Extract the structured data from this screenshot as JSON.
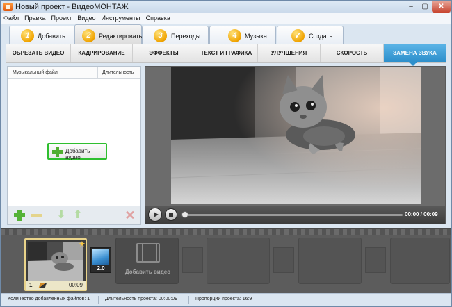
{
  "window": {
    "title": "Новый проект - ВидеоМОНТАЖ"
  },
  "titlebar_buttons": {
    "minimize": "–",
    "maximize": "▢",
    "close": "✕"
  },
  "menu": [
    "Файл",
    "Правка",
    "Проект",
    "Видео",
    "Инструменты",
    "Справка"
  ],
  "main_tabs": [
    {
      "num": "1",
      "label": "Добавить"
    },
    {
      "num": "2",
      "label": "Редактировать",
      "active": true
    },
    {
      "num": "3",
      "label": "Переходы"
    },
    {
      "num": "4",
      "label": "Музыка"
    },
    {
      "num": "",
      "label": "Создать",
      "icon": "checkmark-icon"
    }
  ],
  "sub_tabs": [
    "ОБРЕЗАТЬ ВИДЕО",
    "КАДРИРОВАНИЕ",
    "ЭФФЕКТЫ",
    "ТЕКСТ И ГРАФИКА",
    "УЛУЧШЕНИЯ",
    "СКОРОСТЬ",
    "ЗАМЕНА ЗВУКА"
  ],
  "active_sub_tab": "ЗАМЕНА ЗВУКА",
  "audio_panel": {
    "col_file": "Музыкальный файл",
    "col_duration": "Длительность",
    "add_audio_label": "Добавить аудио"
  },
  "player": {
    "time": "00:00 / 00:09",
    "progress": 0
  },
  "timeline": {
    "clip": {
      "number": "1",
      "duration": "00:09"
    },
    "transition_duration": "2.0",
    "add_video_label": "Добавить видео"
  },
  "status": {
    "files": "Количество добавленных файлов: 1",
    "duration": "Длительность проекта: 00:00:09",
    "ratio": "Пропорции проекта: 16:9"
  },
  "colors": {
    "accent": "#2d8fcb",
    "highlight": "#2fbf2f",
    "tab_number": "#f0a300"
  }
}
